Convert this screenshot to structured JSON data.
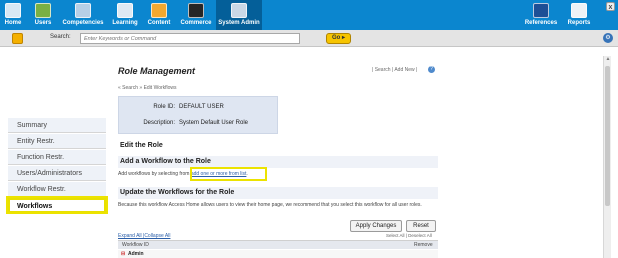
{
  "nav": {
    "items": [
      {
        "label": "Home"
      },
      {
        "label": "Users"
      },
      {
        "label": "Competencies"
      },
      {
        "label": "Learning"
      },
      {
        "label": "Content"
      },
      {
        "label": "Commerce"
      },
      {
        "label": "System Admin"
      }
    ],
    "right_items": [
      {
        "label": "References"
      },
      {
        "label": "Reports"
      }
    ],
    "close": "x"
  },
  "search": {
    "label": "Search:",
    "placeholder": "Enter Keywords or Command",
    "go": "Go ▸"
  },
  "page": {
    "title": "Role Management",
    "top_links": "| Search  | Add New  |",
    "breadcrumb": "« Search » Edit Workflows"
  },
  "role": {
    "id_label": "Role ID:",
    "id_value": "DEFAULT USER",
    "desc_label": "Description:",
    "desc_value": "System Default User Role"
  },
  "tabs": [
    {
      "label": "Summary"
    },
    {
      "label": "Entity Restr."
    },
    {
      "label": "Function Restr."
    },
    {
      "label": "Users/Administrators"
    },
    {
      "label": "Workflow Restr."
    },
    {
      "label": "Workflows",
      "selected": true
    }
  ],
  "sections": {
    "edit_role": "Edit the Role",
    "add_workflow": "Add a Workflow to the Role",
    "add_text_prefix": "Add workflows by selecting from",
    "add_link": "add one or more from list",
    "add_text_suffix": ".",
    "update_workflows": "Update the Workflows for the Role",
    "update_text": "Because this workflow Access Home allows users to view their home page, we recommend that you select this workflow for all user roles."
  },
  "buttons": {
    "apply": "Apply Changes",
    "reset": "Reset"
  },
  "table": {
    "expand_collapse": "Expand All  |Collapse All",
    "select_links": "Select All  |  Deselect All",
    "col_workflow": "Workflow ID",
    "col_remove": "Remove",
    "rows": [
      {
        "name": "Admin"
      }
    ]
  },
  "colors": {
    "nav_bg": "#0b86cf",
    "highlight": "#ece300",
    "link": "#2a5ea8"
  }
}
